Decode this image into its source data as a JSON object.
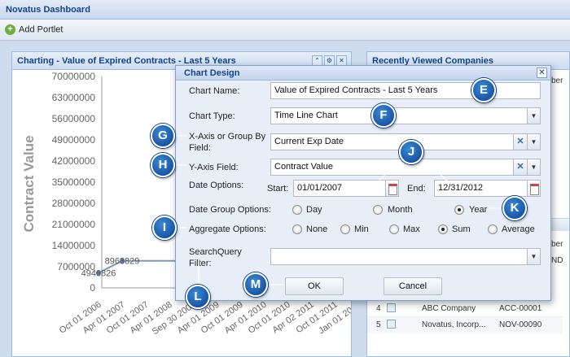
{
  "app": {
    "title": "Novatus Dashboard"
  },
  "toolbar": {
    "add_portlet": "Add Portlet"
  },
  "left_portlet": {
    "title": "Charting - Value of Expired Contracts - Last 5 Years"
  },
  "right_portlet": {
    "title": "Recently Viewed Companies",
    "partial_texts": [
      "ber",
      "ber",
      "ND"
    ],
    "rows": [
      {
        "num": "4",
        "name": "ABC Company",
        "code": "ACC-00001"
      },
      {
        "num": "5",
        "name": "Novatus, Incorp...",
        "code": "NOV-00090"
      }
    ]
  },
  "chart_data": {
    "type": "line",
    "xlabel": "Current Exp Date",
    "ylabel": "Contract Value",
    "ylim": [
      0,
      70000000
    ],
    "yticks": [
      "70000000",
      "63000000",
      "56000000",
      "49000000",
      "42000000",
      "35000000",
      "28000000",
      "21000000",
      "14000000",
      "7000000",
      "0"
    ],
    "xticks": [
      "Oct 01 2006",
      "Apr 01 2007",
      "Oct 01 2007",
      "Apr 01 2008",
      "Sep 30 2008",
      "Apr 01 2009",
      "Oct 01 2009",
      "Apr 01 2010",
      "Oct 01 2010",
      "Apr 02 2011",
      "Oct 01 2011",
      "Jan 01 2012"
    ],
    "point_labels": [
      "4946826",
      "8963829"
    ],
    "series": [
      {
        "x": [
          "Oct 01 2006",
          "Apr 01 2007"
        ],
        "values": [
          4946826,
          8963829
        ]
      }
    ]
  },
  "dialog": {
    "title": "Chart Design",
    "chart_name_label": "Chart Name:",
    "chart_name_value": "Value of Expired Contracts - Last 5 Years",
    "chart_type_label": "Chart Type:",
    "chart_type_value": "Time Line Chart",
    "xaxis_label_1": "X-Axis or Group By",
    "xaxis_label_2": "Field:",
    "xaxis_value": "Current Exp Date",
    "yaxis_label": "Y-Axis Field:",
    "yaxis_value": "Contract Value",
    "date_options_label": "Date Options:",
    "start_label": "Start:",
    "start_value": "01/01/2007",
    "end_label": "End:",
    "end_value": "12/31/2012",
    "date_group_label": "Date Group Options:",
    "date_group_options": [
      "Day",
      "Month",
      "Year"
    ],
    "date_group_selected": "Year",
    "aggregate_label": "Aggregate Options:",
    "aggregate_options": [
      "None",
      "Min",
      "Max",
      "Sum",
      "Average"
    ],
    "aggregate_selected": "Sum",
    "search_label_1": "SearchQuery",
    "search_label_2": "Filter:",
    "search_value": "",
    "ok_label": "OK",
    "cancel_label": "Cancel"
  },
  "badges": [
    "E",
    "F",
    "G",
    "H",
    "I",
    "J",
    "K",
    "L",
    "M"
  ],
  "colors": {
    "accent": "#15428b",
    "badge": "#0b3f8f",
    "header": "#c9d8ed"
  }
}
